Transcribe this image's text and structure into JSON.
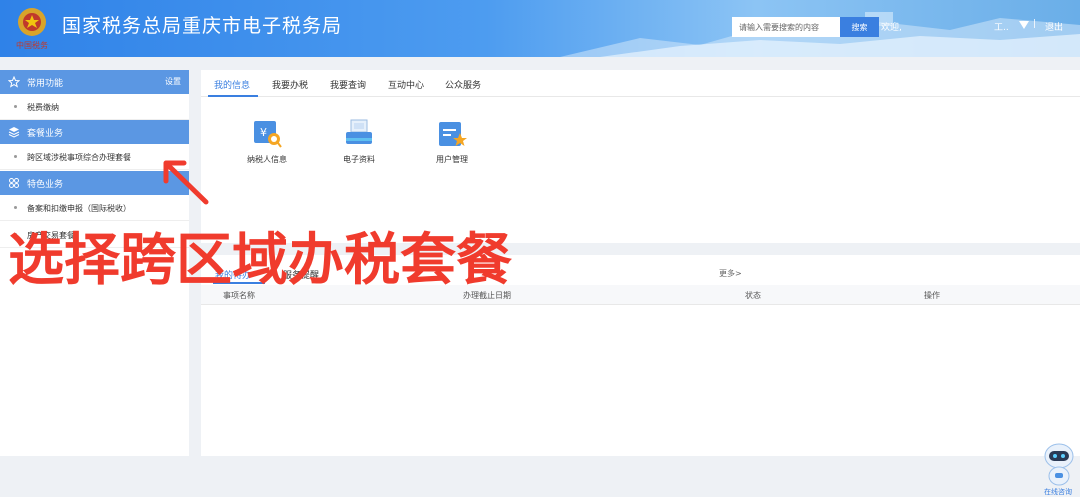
{
  "header": {
    "site_title": "国家税务总局重庆市电子税务局",
    "emblem_text": "中国税务",
    "search_placeholder": "请输入需要搜索的内容",
    "search_button": "搜索",
    "welcome": "欢迎,",
    "user_name": "工..",
    "separator": "|",
    "logout": "退出"
  },
  "sidebar": {
    "sections": [
      {
        "icon": "star-icon",
        "title": "常用功能",
        "link": "设置",
        "items": [
          "税费缴纳"
        ]
      },
      {
        "icon": "layers-icon",
        "title": "套餐业务",
        "items": [
          "跨区域涉税事项综合办理套餐"
        ]
      },
      {
        "icon": "grid-icon",
        "title": "特色业务",
        "items": [
          "备案和扣缴申报（国际税收）",
          "房产交易套餐"
        ]
      }
    ]
  },
  "top_panel": {
    "tabs": [
      "我的信息",
      "我要办税",
      "我要查询",
      "互动中心",
      "公众服务"
    ],
    "tiles": [
      {
        "icon": "taxpayer-info-icon",
        "label": "纳税人信息"
      },
      {
        "icon": "electronic-docs-icon",
        "label": "电子资料"
      },
      {
        "icon": "user-management-icon",
        "label": "用户管理"
      }
    ]
  },
  "bottom_panel": {
    "tabs": [
      "我的待办",
      "服务提醒"
    ],
    "more": "更多>",
    "columns": [
      "事项名称",
      "办理截止日期",
      "状态",
      "操作"
    ]
  },
  "annotation": "选择跨区域办税套餐",
  "assistant": {
    "label": "在线咨询",
    "icon": "robot-assistant-icon"
  },
  "colors": {
    "accent": "#3a7fe0",
    "section_header": "#5b97e3",
    "annotation": "#f03b2d"
  }
}
